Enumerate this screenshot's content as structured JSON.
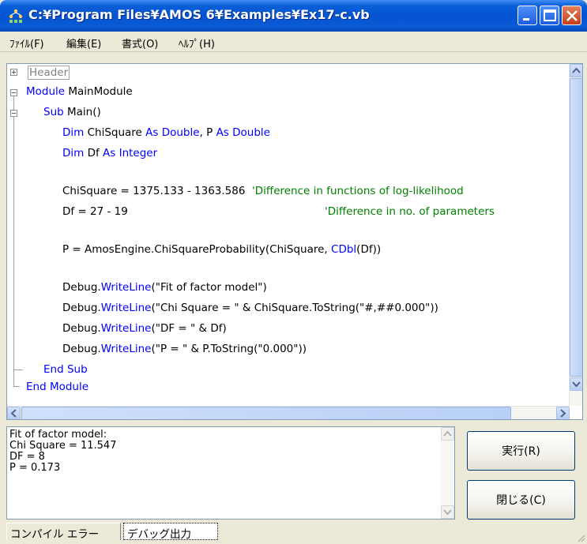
{
  "window": {
    "title": "C:¥Program Files¥AMOS 6¥Examples¥Ex17-c.vb"
  },
  "menu": {
    "items": [
      "ﾌｧｲﾙ(F)",
      "編集(E)",
      "書式(O)",
      "ﾍﾙﾌﾟ(H)"
    ]
  },
  "editor": {
    "header_label": "Header",
    "lines": {
      "module": [
        "Module",
        " MainModule"
      ],
      "sub": [
        "Sub",
        " Main()"
      ],
      "dim1": [
        "Dim",
        " ChiSquare ",
        "As Double",
        ", P ",
        "As Double"
      ],
      "dim2": [
        "Dim",
        " Df ",
        "As Integer"
      ],
      "chisq": [
        "ChiSquare = 1375.133 - 1363.586  ",
        "'Difference in functions of log-likelihood"
      ],
      "df": [
        "Df = 27 - 19",
        "'Difference in no. of parameters"
      ],
      "p": [
        "P = AmosEngine.ChiSquareProbability(ChiSquare, ",
        "CDbl",
        "(Df))"
      ],
      "w1": [
        "Debug.",
        "WriteLine",
        "(\"Fit of factor model\")"
      ],
      "w2": [
        "Debug.",
        "WriteLine",
        "(\"Chi Square = \" & ChiSquare.ToString(\"#,##0.000\"))"
      ],
      "w3": [
        "Debug.",
        "WriteLine",
        "(\"DF = \" & Df)"
      ],
      "w4": [
        "Debug.",
        "WriteLine",
        "(\"P = \" & P.ToString(\"0.000\"))"
      ],
      "endsub": "End Sub",
      "endmodule": "End Module"
    }
  },
  "output": {
    "lines": [
      "Fit of factor model:",
      "Chi Square = 11.547",
      "DF = 8",
      "P = 0.173"
    ]
  },
  "buttons": {
    "run": "実行(R)",
    "close": "閉じる(C)"
  },
  "tabs": {
    "compile_errors": "コンパイル エラー",
    "debug_output": "デバッグ出力"
  },
  "colors": {
    "keyword": "#0000ff",
    "comment": "#008000",
    "titlebar": "#0553d1"
  }
}
